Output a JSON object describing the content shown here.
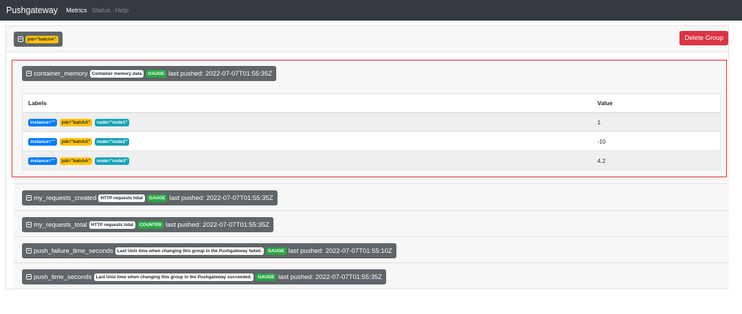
{
  "nav": {
    "brand": "Pushgateway",
    "items": [
      "Metrics",
      "Status",
      "Help"
    ]
  },
  "group": {
    "label": "job=\"batchA\"",
    "delete_label": "Delete Group"
  },
  "metrics": [
    {
      "name": "container_memory",
      "help": "Container memory data",
      "type": "GAUGE",
      "pushed": "last pushed: 2022-07-07T01:55:35Z",
      "table": {
        "headers": [
          "Labels",
          "Value"
        ],
        "rows": [
          {
            "instance": "instance=\"\"",
            "job": "job=\"batchA\"",
            "node": "node=\"node1\"",
            "value": "1"
          },
          {
            "instance": "instance=\"\"",
            "job": "job=\"batchA\"",
            "node": "node=\"node2\"",
            "value": "-10"
          },
          {
            "instance": "instance=\"\"",
            "job": "job=\"batchA\"",
            "node": "node=\"node3\"",
            "value": "4.2"
          }
        ]
      }
    },
    {
      "name": "my_requests_created",
      "help": "HTTP requests total",
      "type": "GAUGE",
      "pushed": "last pushed: 2022-07-07T01:55:35Z"
    },
    {
      "name": "my_requests_total",
      "help": "HTTP requests total",
      "type": "COUNTER",
      "pushed": "last pushed: 2022-07-07T01:55:35Z"
    },
    {
      "name": "push_failure_time_seconds",
      "help": "Last Unix time when changing this group in the Pushgateway failed.",
      "type": "GAUGE",
      "pushed": "last pushed: 2022-07-07T01:55:10Z"
    },
    {
      "name": "push_time_seconds",
      "help": "Last Unix time when changing this group in the Pushgateway succeeded.",
      "type": "GAUGE",
      "pushed": "last pushed: 2022-07-07T01:55:35Z"
    }
  ]
}
